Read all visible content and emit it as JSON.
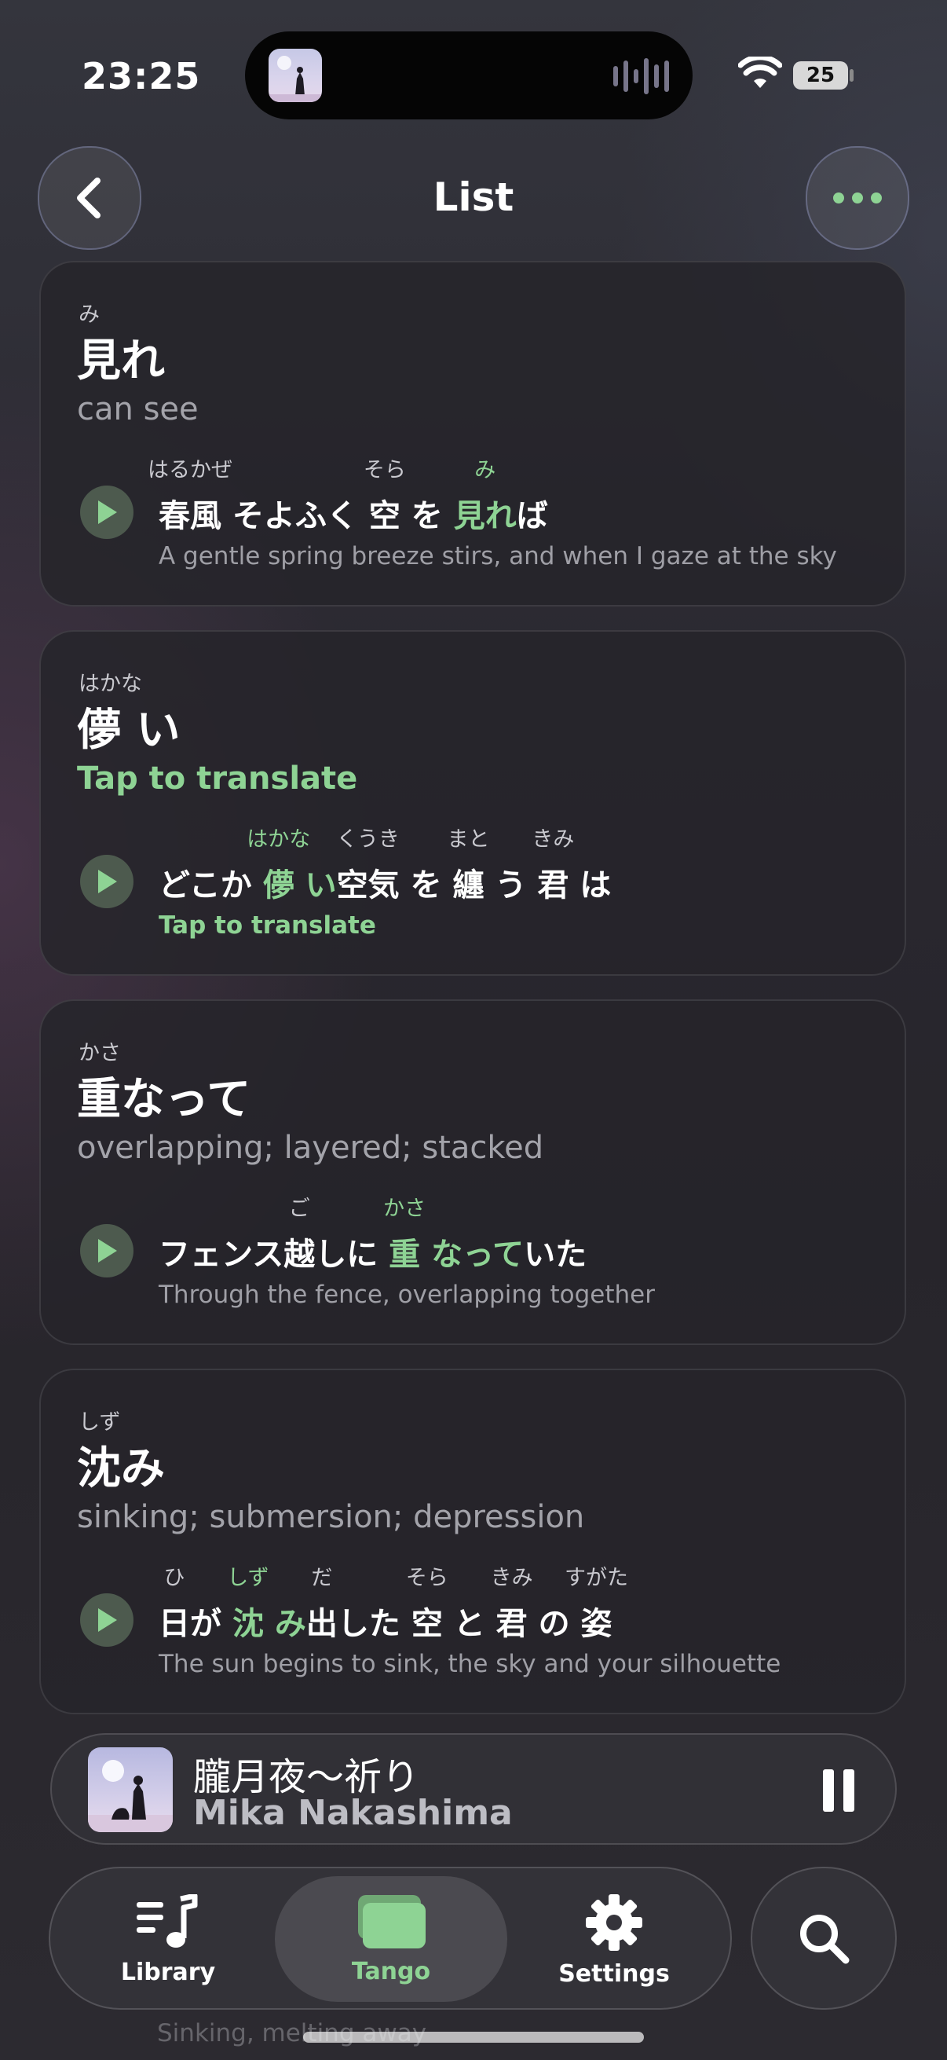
{
  "status_bar": {
    "time": "23:25",
    "battery": "25"
  },
  "header": {
    "title": "List"
  },
  "cards": [
    {
      "furigana": "み",
      "word": "見れ",
      "meaning": "can see",
      "meaning_is_prompt": false,
      "sentence": [
        {
          "text": "春風",
          "rt": "はるかぜ"
        },
        {
          "text": " そよふく "
        },
        {
          "text": "空",
          "rt": "そら"
        },
        {
          "text": " を "
        },
        {
          "text": "見れ",
          "rt": "み",
          "hl": true
        },
        {
          "text": "ば"
        }
      ],
      "translation": "A gentle spring breeze stirs, and when I gaze at the sky",
      "translation_is_prompt": false
    },
    {
      "furigana": "はかな",
      "word": "儚 い",
      "meaning": "Tap to translate",
      "meaning_is_prompt": true,
      "sentence": [
        {
          "text": "どこか "
        },
        {
          "text": "儚",
          "rt": "はかな",
          "hl": true
        },
        {
          "text": " い",
          "hl": true
        },
        {
          "text": "空気",
          "rt": "くうき"
        },
        {
          "text": " を "
        },
        {
          "text": "纏",
          "rt": "まと"
        },
        {
          "text": " う "
        },
        {
          "text": "君",
          "rt": "きみ"
        },
        {
          "text": " は"
        }
      ],
      "translation": "Tap to translate",
      "translation_is_prompt": true
    },
    {
      "furigana": "かさ",
      "word": "重なって",
      "meaning": "overlapping; layered; stacked",
      "meaning_is_prompt": false,
      "sentence": [
        {
          "text": "フェンス"
        },
        {
          "text": "越",
          "rt": "ご"
        },
        {
          "text": "しに "
        },
        {
          "text": "重",
          "rt": "かさ",
          "hl": true
        },
        {
          "text": " なって",
          "hl": true
        },
        {
          "text": "いた"
        }
      ],
      "translation": "Through the fence, overlapping together",
      "translation_is_prompt": false
    },
    {
      "furigana": "しず",
      "word": "沈み",
      "meaning": "sinking; submersion; depression",
      "meaning_is_prompt": false,
      "sentence": [
        {
          "text": "日",
          "rt": "ひ"
        },
        {
          "text": "が "
        },
        {
          "text": "沈",
          "rt": "しず",
          "hl": true
        },
        {
          "text": " み",
          "hl": true
        },
        {
          "text": "出",
          "rt": "だ"
        },
        {
          "text": "した "
        },
        {
          "text": "空",
          "rt": "そら"
        },
        {
          "text": " と "
        },
        {
          "text": "君",
          "rt": "きみ"
        },
        {
          "text": " の "
        },
        {
          "text": "姿",
          "rt": "すがた"
        }
      ],
      "translation": "The sun begins to sink, the sky and your silhouette",
      "translation_is_prompt": false
    }
  ],
  "peek_text": "Sinking, melting away",
  "player": {
    "title": "朧月夜～祈り",
    "artist": "Mika Nakashima"
  },
  "tabs": [
    {
      "label": "Library",
      "icon": "music-list-icon",
      "active": false
    },
    {
      "label": "Tango",
      "icon": "cards-icon",
      "active": true
    },
    {
      "label": "Settings",
      "icon": "gear-icon",
      "active": false
    }
  ],
  "colors": {
    "accent": "#8ed394",
    "background": "#2a2830",
    "card": "#26242a"
  }
}
